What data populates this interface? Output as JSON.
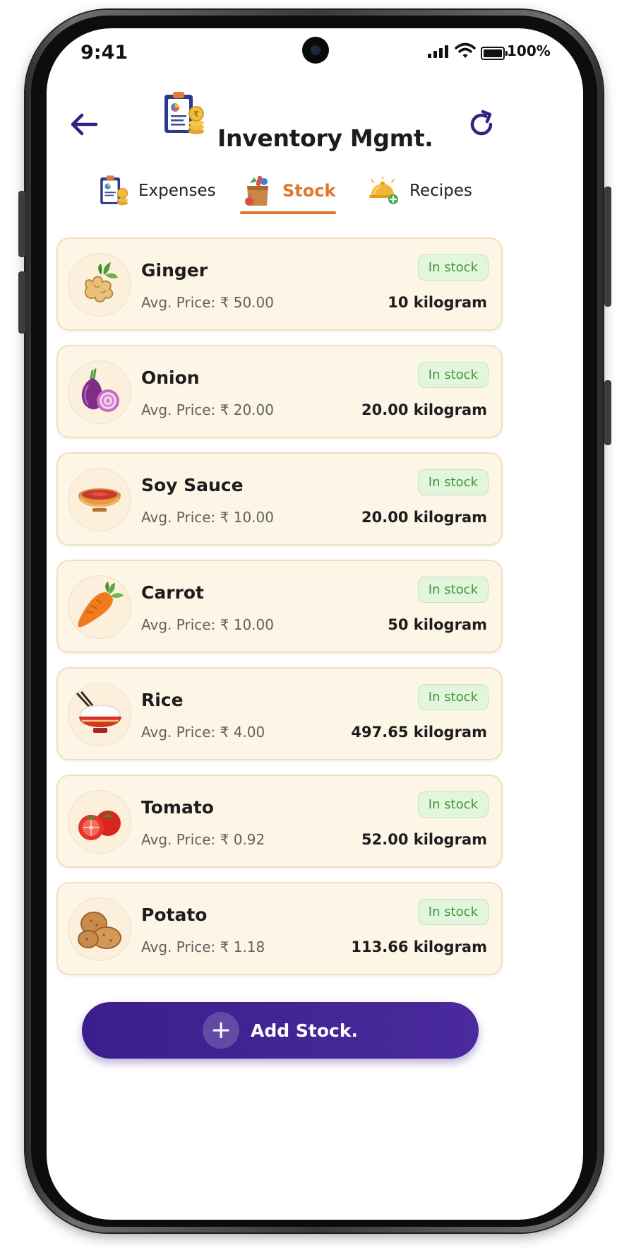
{
  "status_bar": {
    "time": "9:41",
    "battery": "100%"
  },
  "header": {
    "title": "Inventory Mgmt."
  },
  "tabs": [
    {
      "label": "Expenses",
      "active": false
    },
    {
      "label": "Stock",
      "active": true
    },
    {
      "label": "Recipes",
      "active": false
    }
  ],
  "items": [
    {
      "name": "Ginger",
      "price": "Avg. Price: ₹ 50.00",
      "status": "In stock",
      "quantity": "10 kilogram",
      "icon": "ginger-icon"
    },
    {
      "name": "Onion",
      "price": "Avg. Price: ₹ 20.00",
      "status": "In stock",
      "quantity": "20.00 kilogram",
      "icon": "onion-icon"
    },
    {
      "name": "Soy Sauce",
      "price": "Avg. Price: ₹ 10.00",
      "status": "In stock",
      "quantity": "20.00 kilogram",
      "icon": "soy-sauce-icon"
    },
    {
      "name": "Carrot",
      "price": "Avg. Price: ₹ 10.00",
      "status": "In stock",
      "quantity": "50 kilogram",
      "icon": "carrot-icon"
    },
    {
      "name": "Rice",
      "price": "Avg. Price: ₹ 4.00",
      "status": "In stock",
      "quantity": "497.65 kilogram",
      "icon": "rice-bowl-icon"
    },
    {
      "name": "Tomato",
      "price": "Avg. Price: ₹ 0.92",
      "status": "In stock",
      "quantity": "52.00 kilogram",
      "icon": "tomato-icon"
    },
    {
      "name": "Potato",
      "price": "Avg. Price: ₹ 1.18",
      "status": "In stock",
      "quantity": "113.66 kilogram",
      "icon": "potato-icon"
    }
  ],
  "add_button": {
    "label": "Add Stock."
  },
  "colors": {
    "accent": "#e2752a",
    "primary": "#3a1f8c",
    "card_bg": "#fdf5e6",
    "badge_bg": "#e3f5dc",
    "badge_text": "#3a9a35"
  }
}
